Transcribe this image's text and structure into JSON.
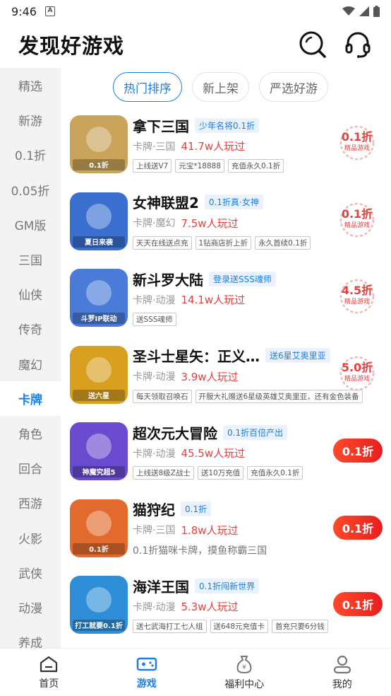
{
  "status_bar": {
    "time": "9:46",
    "notification_icon": "A"
  },
  "header": {
    "title": "发现好游戏",
    "search_icon": "search-icon",
    "support_icon": "headset-icon"
  },
  "sidebar": {
    "categories": [
      "精选",
      "新游",
      "0.1折",
      "0.05折",
      "GM版",
      "三国",
      "仙侠",
      "传奇",
      "魔幻",
      "卡牌",
      "角色",
      "回合",
      "西游",
      "火影",
      "武侠",
      "动漫",
      "养成"
    ],
    "active": "卡牌"
  },
  "tabs": [
    "热门排序",
    "新上架",
    "严选好游"
  ],
  "games": [
    {
      "name": "拿下三国",
      "tag": "少年名将0.1折",
      "genre": "卡牌·三国",
      "players": "41.7w人玩过",
      "perks": [
        "上线送V7",
        "元宝*18888",
        "充值永久0.1折"
      ],
      "desc": "",
      "badge": "0.1折",
      "badge_sub": "精品游戏",
      "badge_style": "seal",
      "icon_color": "#c9a45a",
      "icon_label": "0.1折"
    },
    {
      "name": "女神联盟2",
      "tag": "0.1折真·女神",
      "genre": "卡牌·魔幻",
      "players": "7.5w人玩过",
      "perks": [
        "天天在线送点充",
        "1钻商店折上折",
        "永久首续0.1折"
      ],
      "desc": "",
      "badge": "0.1折",
      "badge_sub": "精品游戏",
      "badge_style": "seal",
      "icon_color": "#3a6fd0",
      "icon_label": "夏日来袭"
    },
    {
      "name": "新斗罗大陆",
      "tag": "登录送SSS魂师",
      "genre": "卡牌·动漫",
      "players": "14.1w人玩过",
      "perks": [
        "送SSS魂师"
      ],
      "desc": "",
      "badge": "4.5折",
      "badge_sub": "精品游戏",
      "badge_style": "seal",
      "icon_color": "#4b7bd9",
      "icon_label": "斗罗IP联动"
    },
    {
      "name": "圣斗士星矢：正义传说",
      "tag": "送6星艾奥里亚",
      "genre": "卡牌·动漫",
      "players": "3.9w人玩过",
      "perks": [
        "每天领取召唤石",
        "开服大礼赠送6星级英雄艾奥里亚，还有金色装备"
      ],
      "desc": "",
      "badge": "5.0折",
      "badge_sub": "精品游戏",
      "badge_style": "seal",
      "icon_color": "#d9a020",
      "icon_label": "送六星"
    },
    {
      "name": "超次元大冒险",
      "tag": "0.1折百倍产出",
      "genre": "卡牌·动漫",
      "players": "45.5w人玩过",
      "perks": [
        "上线送8级Z战士",
        "送10万充值",
        "充值永久0.1折"
      ],
      "desc": "",
      "badge": "0.1折",
      "badge_sub": "",
      "badge_style": "button",
      "icon_color": "#6a4bd0",
      "icon_label": "神魔究超5"
    },
    {
      "name": "猫狩纪",
      "tag": "0.1折",
      "genre": "卡牌·三国",
      "players": "1.8w人玩过",
      "perks": [],
      "desc": "0.1折猫咪卡牌，摸鱼称霸三国",
      "badge": "0.1折",
      "badge_sub": "",
      "badge_style": "button",
      "icon_color": "#e26a2c",
      "icon_label": "0.1折"
    },
    {
      "name": "海洋王国",
      "tag": "0.1折闯新世界",
      "genre": "卡牌·动漫",
      "players": "5.3w人玩过",
      "perks": [
        "送七武海打工七人组",
        "送648元充值卡",
        "首充只要6分钱"
      ],
      "desc": "",
      "badge": "0.1折",
      "badge_sub": "",
      "badge_style": "button",
      "icon_color": "#2e8fd8",
      "icon_label": "打工就要0.1折"
    }
  ],
  "bottom_nav": [
    {
      "label": "首页",
      "icon": "home-icon",
      "active": false
    },
    {
      "label": "游戏",
      "icon": "gamepad-icon",
      "active": true
    },
    {
      "label": "福利中心",
      "icon": "money-bag-icon",
      "active": false
    },
    {
      "label": "我的",
      "icon": "user-icon",
      "active": false
    }
  ]
}
